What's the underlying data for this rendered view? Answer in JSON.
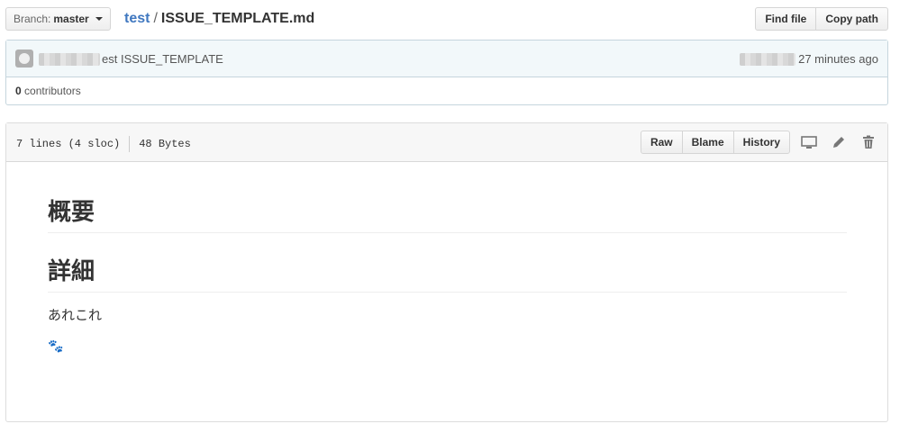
{
  "topbar": {
    "branch_label": "Branch:",
    "branch_value": "master",
    "repo": "test",
    "separator": "/",
    "file_name": "ISSUE_TEMPLATE.md",
    "find_file": "Find file",
    "copy_path": "Copy path"
  },
  "commit": {
    "message": "est ISSUE_TEMPLATE",
    "time": "27 minutes ago",
    "contributors_count": "0",
    "contributors_label": "contributors"
  },
  "file": {
    "lines": "7 lines (4 sloc)",
    "size": "48 Bytes",
    "actions": {
      "raw": "Raw",
      "blame": "Blame",
      "history": "History"
    }
  },
  "content": {
    "heading1": "概要",
    "heading2": "詳細",
    "paragraph": "あれこれ",
    "emoji": "🐾"
  }
}
